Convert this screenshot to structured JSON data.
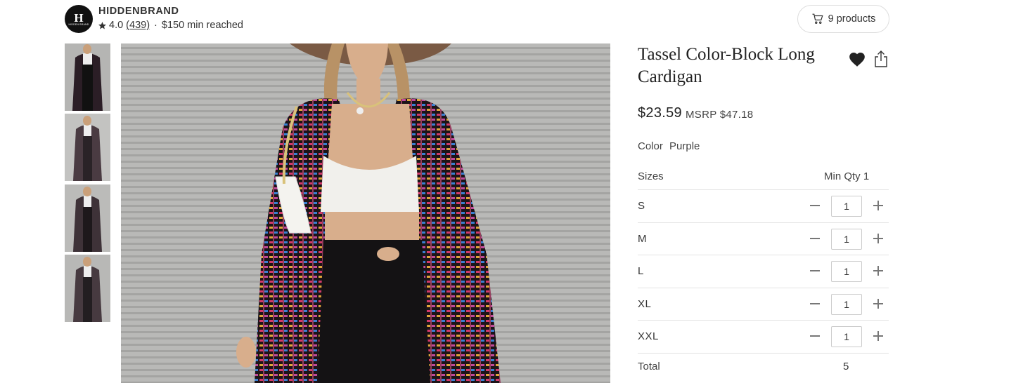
{
  "brand": {
    "logo_letter": "H",
    "logo_text": "HIDDEN BRAND",
    "name": "HIDDENBRAND",
    "rating": "4.0",
    "review_count": "(439)",
    "separator": "·",
    "min_status": "$150 min reached"
  },
  "header": {
    "products_label": "9 products"
  },
  "gallery": {
    "thumbnails": [
      "thumb-1",
      "thumb-2",
      "thumb-3",
      "thumb-4"
    ]
  },
  "product": {
    "title": "Tassel Color-Block Long Cardigan",
    "price": "$23.59",
    "msrp": "MSRP $47.18",
    "color_label": "Color",
    "color_value": "Purple",
    "sizes_label": "Sizes",
    "min_qty_label": "Min Qty 1",
    "sizes": [
      {
        "name": "S",
        "qty": "1"
      },
      {
        "name": "M",
        "qty": "1"
      },
      {
        "name": "L",
        "qty": "1"
      },
      {
        "name": "XL",
        "qty": "1"
      },
      {
        "name": "XXL",
        "qty": "1"
      }
    ],
    "total_label": "Total",
    "total_value": "5"
  },
  "colors": {
    "text": "#333333",
    "border": "#e3e3e3",
    "icon": "#222222"
  }
}
